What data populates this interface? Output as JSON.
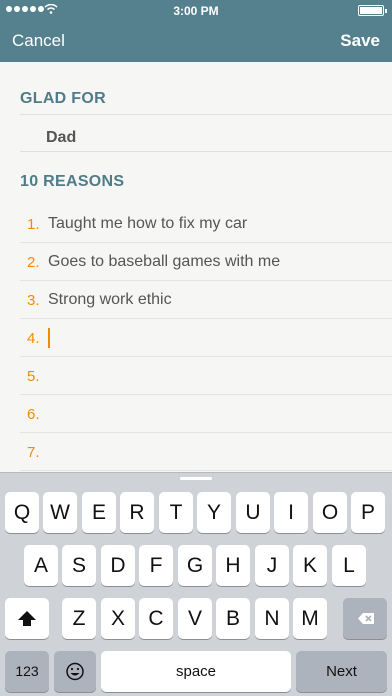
{
  "status_bar": {
    "time": "3:00 PM"
  },
  "nav": {
    "cancel_label": "Cancel",
    "save_label": "Save"
  },
  "glad_for": {
    "heading": "GLAD FOR",
    "name": "Dad"
  },
  "reasons": {
    "heading": "10 REASONS",
    "items": [
      {
        "num": "1.",
        "text": "Taught me how to fix my car"
      },
      {
        "num": "2.",
        "text": "Goes to baseball games with me"
      },
      {
        "num": "3.",
        "text": "Strong work ethic"
      },
      {
        "num": "4.",
        "text": ""
      },
      {
        "num": "5.",
        "text": ""
      },
      {
        "num": "6.",
        "text": ""
      },
      {
        "num": "7.",
        "text": ""
      }
    ]
  },
  "keyboard": {
    "row1": [
      "Q",
      "W",
      "E",
      "R",
      "T",
      "Y",
      "U",
      "I",
      "O",
      "P"
    ],
    "row2": [
      "A",
      "S",
      "D",
      "F",
      "G",
      "H",
      "J",
      "K",
      "L"
    ],
    "row3": [
      "Z",
      "X",
      "C",
      "V",
      "B",
      "N",
      "M"
    ],
    "numbers_label": "123",
    "space_label": "space",
    "next_label": "Next"
  },
  "colors": {
    "header": "#54818d",
    "accent": "#f08c00",
    "section": "#4f7c88"
  }
}
